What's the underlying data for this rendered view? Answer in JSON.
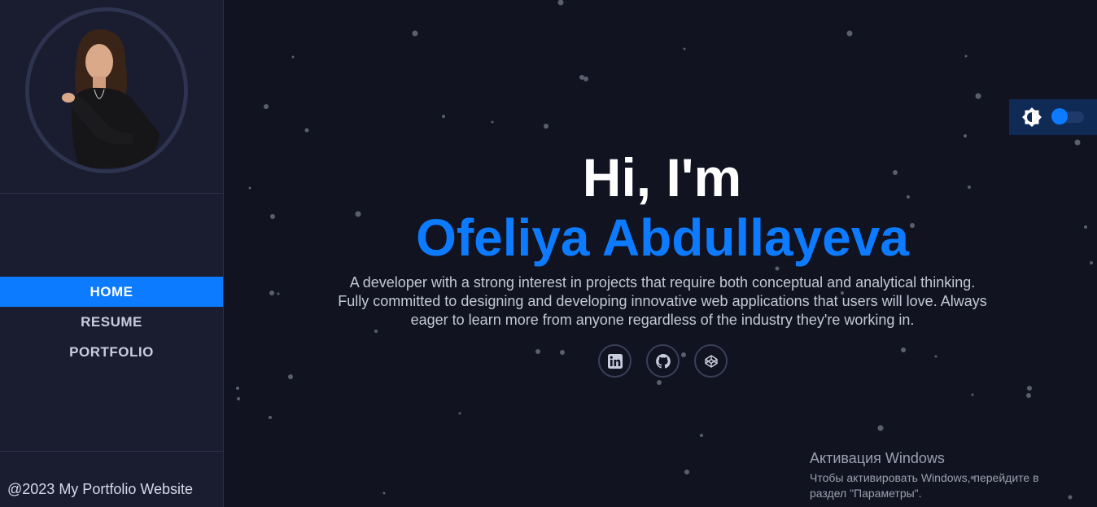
{
  "sidebar": {
    "avatar_alt": "Profile photo",
    "nav": [
      {
        "label": "HOME",
        "active": true
      },
      {
        "label": "RESUME",
        "active": false
      },
      {
        "label": "PORTFOLIO",
        "active": false
      }
    ],
    "footer": "@2023 My Portfolio Website"
  },
  "hero": {
    "greeting": "Hi, I'm",
    "name": "Ofeliya Abdullayeva",
    "bio_line1": "A developer with a strong interest in projects that require both conceptual and analytical thinking.",
    "bio_line2": "Fully committed to designing and developing innovative web applications that users will love. Always",
    "bio_line3": "eager to learn more from anyone regardless of the industry they're working in."
  },
  "socials": [
    {
      "icon": "linkedin-icon"
    },
    {
      "icon": "github-icon"
    },
    {
      "icon": "codepen-icon"
    }
  ],
  "theme": {
    "icon": "brightness-icon",
    "enabled": true
  },
  "windows_activation": {
    "title": "Активация Windows",
    "line1": "Чтобы активировать Windows, перейдите в",
    "line2": "раздел \"Параметры\"."
  },
  "colors": {
    "accent": "#0d7bff",
    "background": "#111320",
    "sidebar": "#1a1d30"
  }
}
